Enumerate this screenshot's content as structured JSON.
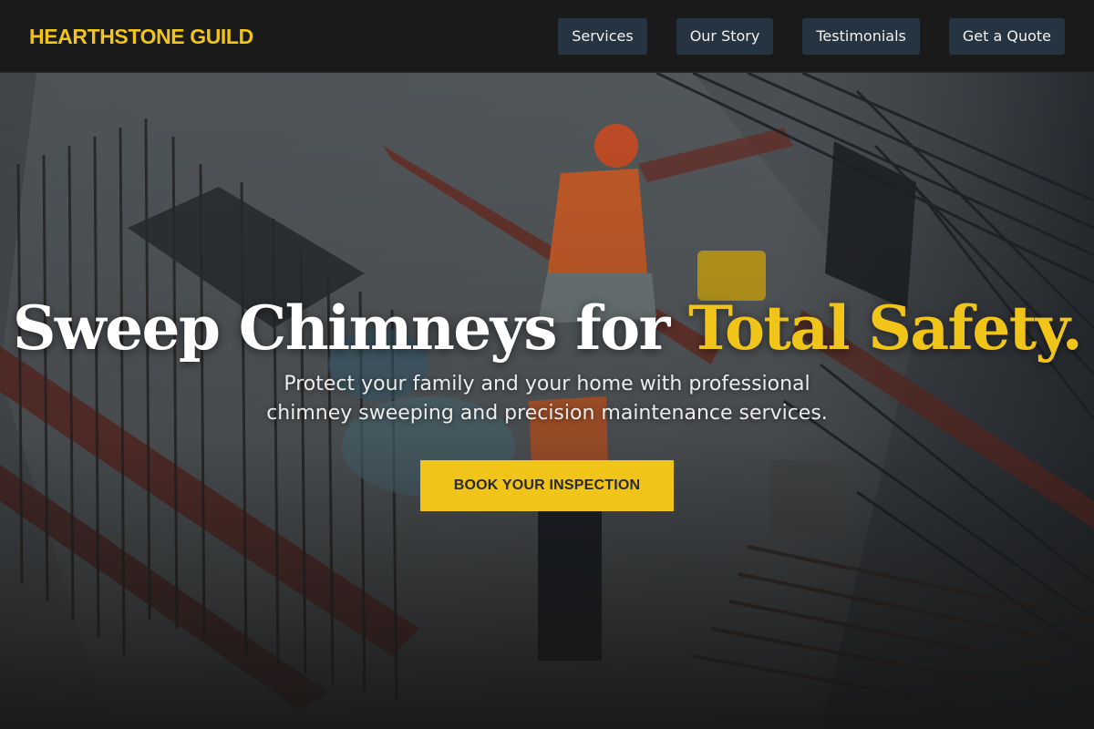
{
  "header": {
    "brand": "HEARTHSTONE GUILD",
    "nav": [
      {
        "label": "Services"
      },
      {
        "label": "Our Story"
      },
      {
        "label": "Testimonials"
      },
      {
        "label": "Get a Quote"
      }
    ]
  },
  "hero": {
    "headline_main": "Sweep Chimneys for ",
    "headline_accent": "Total Safety.",
    "subtitle_line1": "Protect your family and your home with professional",
    "subtitle_line2": "chimney sweeping and precision maintenance services.",
    "cta_label": "BOOK YOUR INSPECTION"
  },
  "colors": {
    "accent": "#f0c419",
    "nav_button": "#263340",
    "header_bg": "#1a1a1a"
  }
}
